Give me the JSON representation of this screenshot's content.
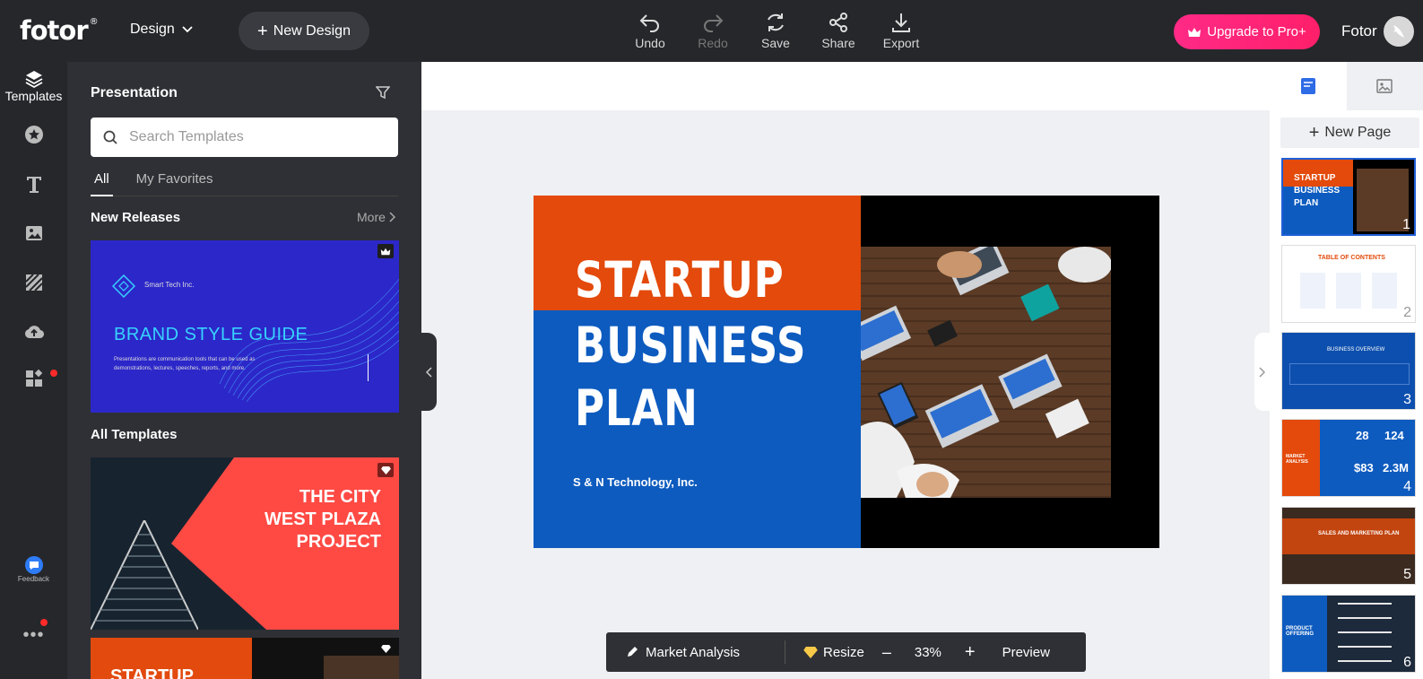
{
  "app": {
    "logo": "fotor",
    "logo_mark": "®"
  },
  "topbar": {
    "design_menu": "Design",
    "new_design": "New Design",
    "tools": [
      {
        "label": "Undo",
        "icon": "undo-icon",
        "enabled": true
      },
      {
        "label": "Redo",
        "icon": "redo-icon",
        "enabled": false
      },
      {
        "label": "Save",
        "icon": "save-icon",
        "enabled": true
      },
      {
        "label": "Share",
        "icon": "share-icon",
        "enabled": true
      },
      {
        "label": "Export",
        "icon": "export-icon",
        "enabled": true
      }
    ],
    "upgrade": "Upgrade to Pro+",
    "user_name": "Fotor"
  },
  "rail": {
    "templates": "Templates",
    "feedback": "Feedback"
  },
  "panel": {
    "title": "Presentation",
    "search_placeholder": "Search Templates",
    "tabs": [
      "All",
      "My Favorites"
    ],
    "new_releases": "New Releases",
    "more": "More",
    "all_templates": "All Templates",
    "card1": {
      "brand": "Smart Tech Inc.",
      "title": "BRAND STYLE GUIDE",
      "subtitle": "Presentations are communication tools that can be used as demonstrations, lectures, speeches, reports, and more."
    },
    "card2": {
      "line1": "THE CITY",
      "line2": "WEST PLAZA",
      "line3": "PROJECT"
    },
    "card3": {
      "title": "STARTUP"
    }
  },
  "slide": {
    "line1": "STARTUP",
    "line2": "BUSINESS",
    "line3": "PLAN",
    "company": "S & N Technology, Inc."
  },
  "bottombar": {
    "page_name": "Market Analysis",
    "resize": "Resize",
    "zoom": "33%",
    "preview": "Preview"
  },
  "rpanel": {
    "new_page": "New Page",
    "pages": [
      {
        "num": "1",
        "label": "STARTUP BUSINESS PLAN"
      },
      {
        "num": "2",
        "label": "TABLE OF CONTENTS"
      },
      {
        "num": "3",
        "label": "BUSINESS OVERVIEW"
      },
      {
        "num": "4",
        "label": "MARKET ANALYSIS",
        "stats": [
          "28",
          "124",
          "$83",
          "2.3M"
        ]
      },
      {
        "num": "5",
        "label": "SALES AND MARKETING PLAN"
      },
      {
        "num": "6",
        "label": "PRODUCT OFFERING"
      }
    ]
  },
  "colors": {
    "accent_blue": "#0d5bbf",
    "accent_orange": "#e34a0b",
    "upgrade_pink": "#ff2a86"
  }
}
